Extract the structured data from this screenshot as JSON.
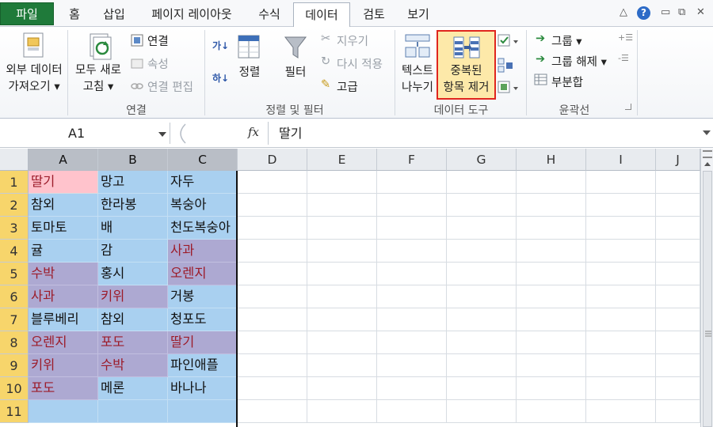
{
  "tabs": [
    "파일",
    "홈",
    "삽입",
    "페이지 레이아웃",
    "수식",
    "데이터",
    "검토",
    "보기"
  ],
  "active_tab": "데이터",
  "window_controls": {
    "minimize_ribbon": "△",
    "help": "?",
    "minimize": "▭",
    "restore": "⧉",
    "close": "✕"
  },
  "ribbon": {
    "external_data": {
      "line1": "외부 데이터",
      "line2": "가져오기 ▾"
    },
    "refresh_all": {
      "line1": "모두 새로",
      "line2": "고침 ▾"
    },
    "connections": {
      "connections": "연결",
      "properties": "속성",
      "edit_links": "연결 편집",
      "group_label": "연결"
    },
    "sort_filter": {
      "sort": "정렬",
      "filter": "필터",
      "clear": "지우기",
      "reapply": "다시 적용",
      "advanced": "고급",
      "sort_az": "가↓",
      "sort_za": "하↓",
      "group_label": "정렬 및 필터"
    },
    "data_tools": {
      "text_to_columns_1": "텍스트",
      "text_to_columns_2": "나누기",
      "remove_dup_1": "중복된",
      "remove_dup_2": "항목 제거",
      "group_label": "데이터 도구"
    },
    "outline": {
      "group": "그룹 ▾",
      "ungroup": "그룹 해제 ▾",
      "subtotal": "부분합",
      "group_label": "윤곽선"
    }
  },
  "formula_bar": {
    "name_box": "A1",
    "fx": "fx",
    "content": "딸기"
  },
  "columns": [
    "A",
    "B",
    "C",
    "D",
    "E",
    "F",
    "G",
    "H",
    "I",
    "J"
  ],
  "rows": [
    "1",
    "2",
    "3",
    "4",
    "5",
    "6",
    "7",
    "8",
    "9",
    "10",
    "11"
  ],
  "cells": [
    [
      "딸기",
      "망고",
      "자두"
    ],
    [
      "참외",
      "한라봉",
      "복숭아"
    ],
    [
      "토마토",
      "배",
      "천도복숭아"
    ],
    [
      "귤",
      "감",
      "사과"
    ],
    [
      "수박",
      "홍시",
      "오렌지"
    ],
    [
      "사과",
      "키위",
      "거봉"
    ],
    [
      "블루베리",
      "참외",
      "청포도"
    ],
    [
      "오렌지",
      "포도",
      "딸기"
    ],
    [
      "키위",
      "수박",
      "파인애플"
    ],
    [
      "포도",
      "메론",
      "바나나"
    ],
    [
      "",
      "",
      ""
    ]
  ],
  "duplicates": [
    [
      3,
      2
    ],
    [
      4,
      0
    ],
    [
      4,
      2
    ],
    [
      5,
      0
    ],
    [
      5,
      1
    ],
    [
      7,
      0
    ],
    [
      7,
      1
    ],
    [
      7,
      2
    ],
    [
      8,
      0
    ],
    [
      8,
      1
    ],
    [
      9,
      0
    ]
  ],
  "colors": {
    "selection_blue": "#a9d0f0",
    "duplicate_fill": "#ada9d2",
    "duplicate_text": "#9c1c2a",
    "active_cell_fill": "#ffc3cc",
    "highlight_box": "#e0261e",
    "file_tab": "#1f7a3a"
  }
}
